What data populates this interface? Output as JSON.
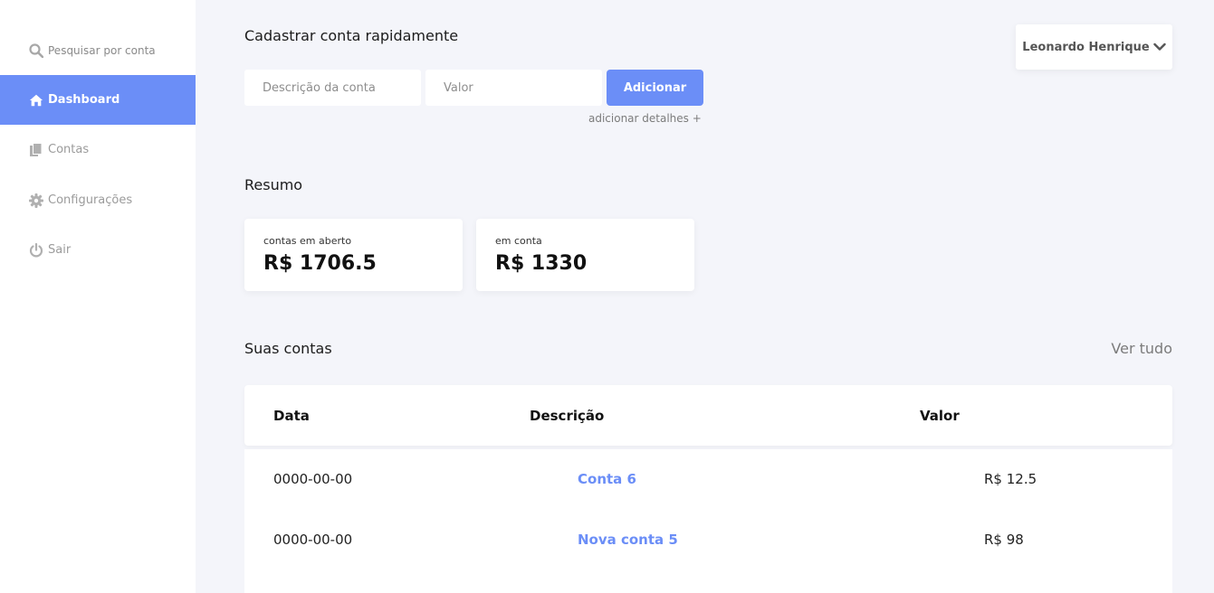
{
  "sidebar": {
    "search_label": "Pesquisar por conta",
    "items": [
      {
        "label": "Dashboard",
        "icon": "home-icon",
        "active": true
      },
      {
        "label": "Contas",
        "icon": "copy-icon",
        "active": false
      },
      {
        "label": "Configurações",
        "icon": "gear-icon",
        "active": false
      },
      {
        "label": "Sair",
        "icon": "power-icon",
        "active": false
      }
    ]
  },
  "quick_add": {
    "title": "Cadastrar conta rapidamente",
    "description_placeholder": "Descrição da conta",
    "value_placeholder": "Valor",
    "add_label": "Adicionar",
    "details_link": "adicionar detalhes +"
  },
  "user": {
    "name": "Leonardo Henrique"
  },
  "summary": {
    "title": "Resumo",
    "cards": [
      {
        "label": "contas em aberto",
        "value": "R$ 1706.5"
      },
      {
        "label": "em conta",
        "value": "R$ 1330"
      }
    ]
  },
  "accounts": {
    "title": "Suas contas",
    "see_all": "Ver tudo",
    "columns": [
      "Data",
      "Descrição",
      "Valor"
    ],
    "rows": [
      {
        "date": "0000-00-00",
        "description": "Conta 6",
        "value": "R$ 12.5"
      },
      {
        "date": "0000-00-00",
        "description": "Nova conta 5",
        "value": "R$ 98"
      }
    ]
  },
  "colors": {
    "accent": "#6b8ef7",
    "background": "#f4f5fa",
    "sidebar": "#ffffff"
  }
}
